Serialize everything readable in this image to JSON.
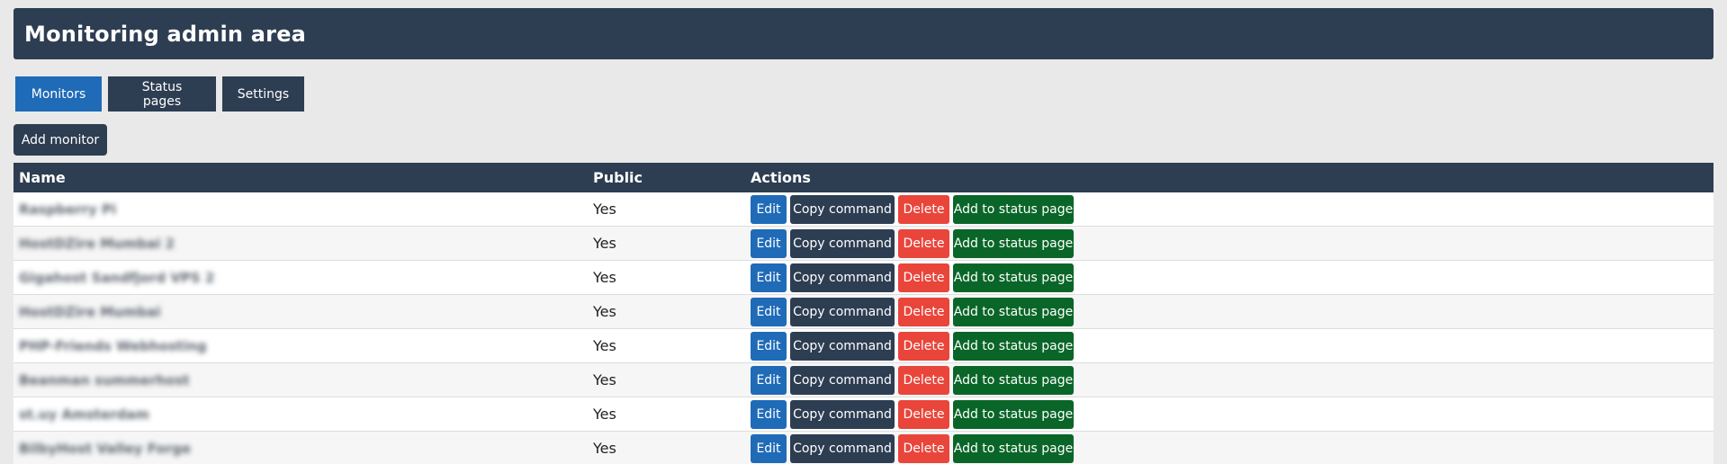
{
  "header": {
    "title": "Monitoring admin area"
  },
  "tabs": [
    {
      "label": "Monitors",
      "active": true
    },
    {
      "label": "Status pages",
      "active": false
    },
    {
      "label": "Settings",
      "active": false
    }
  ],
  "toolbar": {
    "add_monitor_label": "Add monitor"
  },
  "table": {
    "columns": [
      "Name",
      "Public",
      "Actions"
    ],
    "action_labels": {
      "edit": "Edit",
      "copy": "Copy command",
      "delete": "Delete",
      "add_to_status_page": "Add to status page"
    },
    "rows": [
      {
        "name": "Raspberry Pi",
        "public": "Yes"
      },
      {
        "name": "HostDZire Mumbai 2",
        "public": "Yes"
      },
      {
        "name": "Gigahost Sandfjord VPS 2",
        "public": "Yes"
      },
      {
        "name": "HostDZire Mumbai",
        "public": "Yes"
      },
      {
        "name": "PHP-Friends Webhosting",
        "public": "Yes"
      },
      {
        "name": "Beanman summerhost",
        "public": "Yes"
      },
      {
        "name": "st.uy Amsterdam",
        "public": "Yes"
      },
      {
        "name": "BilbyHost Valley Forge",
        "public": "Yes"
      }
    ]
  },
  "colors": {
    "primary_dark": "#2d3d52",
    "blue": "#1f6bb8",
    "red": "#e9453a",
    "green": "#0a6628",
    "background": "#e9e9e9"
  }
}
